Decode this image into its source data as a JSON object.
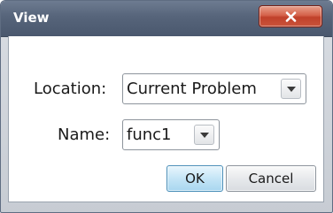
{
  "window": {
    "title": "View",
    "close_label": "X"
  },
  "form": {
    "location_label": "Location:",
    "location_value": "Current Problem",
    "name_label": "Name:",
    "name_value": "func1"
  },
  "buttons": {
    "ok_label": "OK",
    "cancel_label": "Cancel"
  },
  "icons": {
    "close": "close-icon",
    "dropdown": "chevron-down-icon"
  },
  "colors": {
    "titlebar": "#56647a",
    "close_button": "#c9543b",
    "ok_button": "#c4e5f6"
  }
}
